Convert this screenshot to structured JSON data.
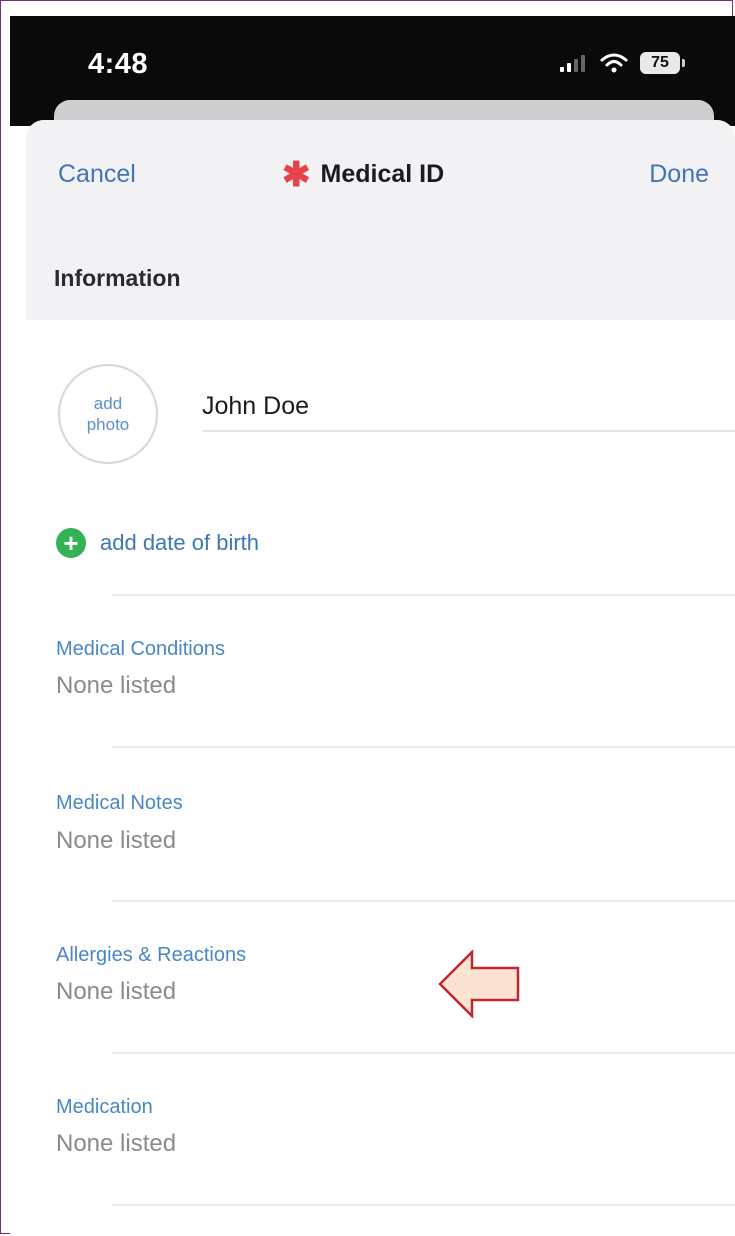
{
  "status_bar": {
    "time": "4:48",
    "battery": "75"
  },
  "nav": {
    "cancel": "Cancel",
    "title": "Medical ID",
    "done": "Done"
  },
  "section_header": "Information",
  "profile": {
    "add_photo_line1": "add",
    "add_photo_line2": "photo",
    "name": "John Doe"
  },
  "add_dob": "add date of birth",
  "fields": [
    {
      "label": "Medical Conditions",
      "value": "None listed"
    },
    {
      "label": "Medical Notes",
      "value": "None listed"
    },
    {
      "label": "Allergies & Reactions",
      "value": "None listed"
    },
    {
      "label": "Medication",
      "value": "None listed"
    }
  ],
  "colors": {
    "accent_blue": "#3f76b6",
    "medical_star": "#e8414a",
    "add_green": "#34b356",
    "annotation_arrow_fill": "#fbe3d3",
    "annotation_arrow_stroke": "#c0262d"
  }
}
